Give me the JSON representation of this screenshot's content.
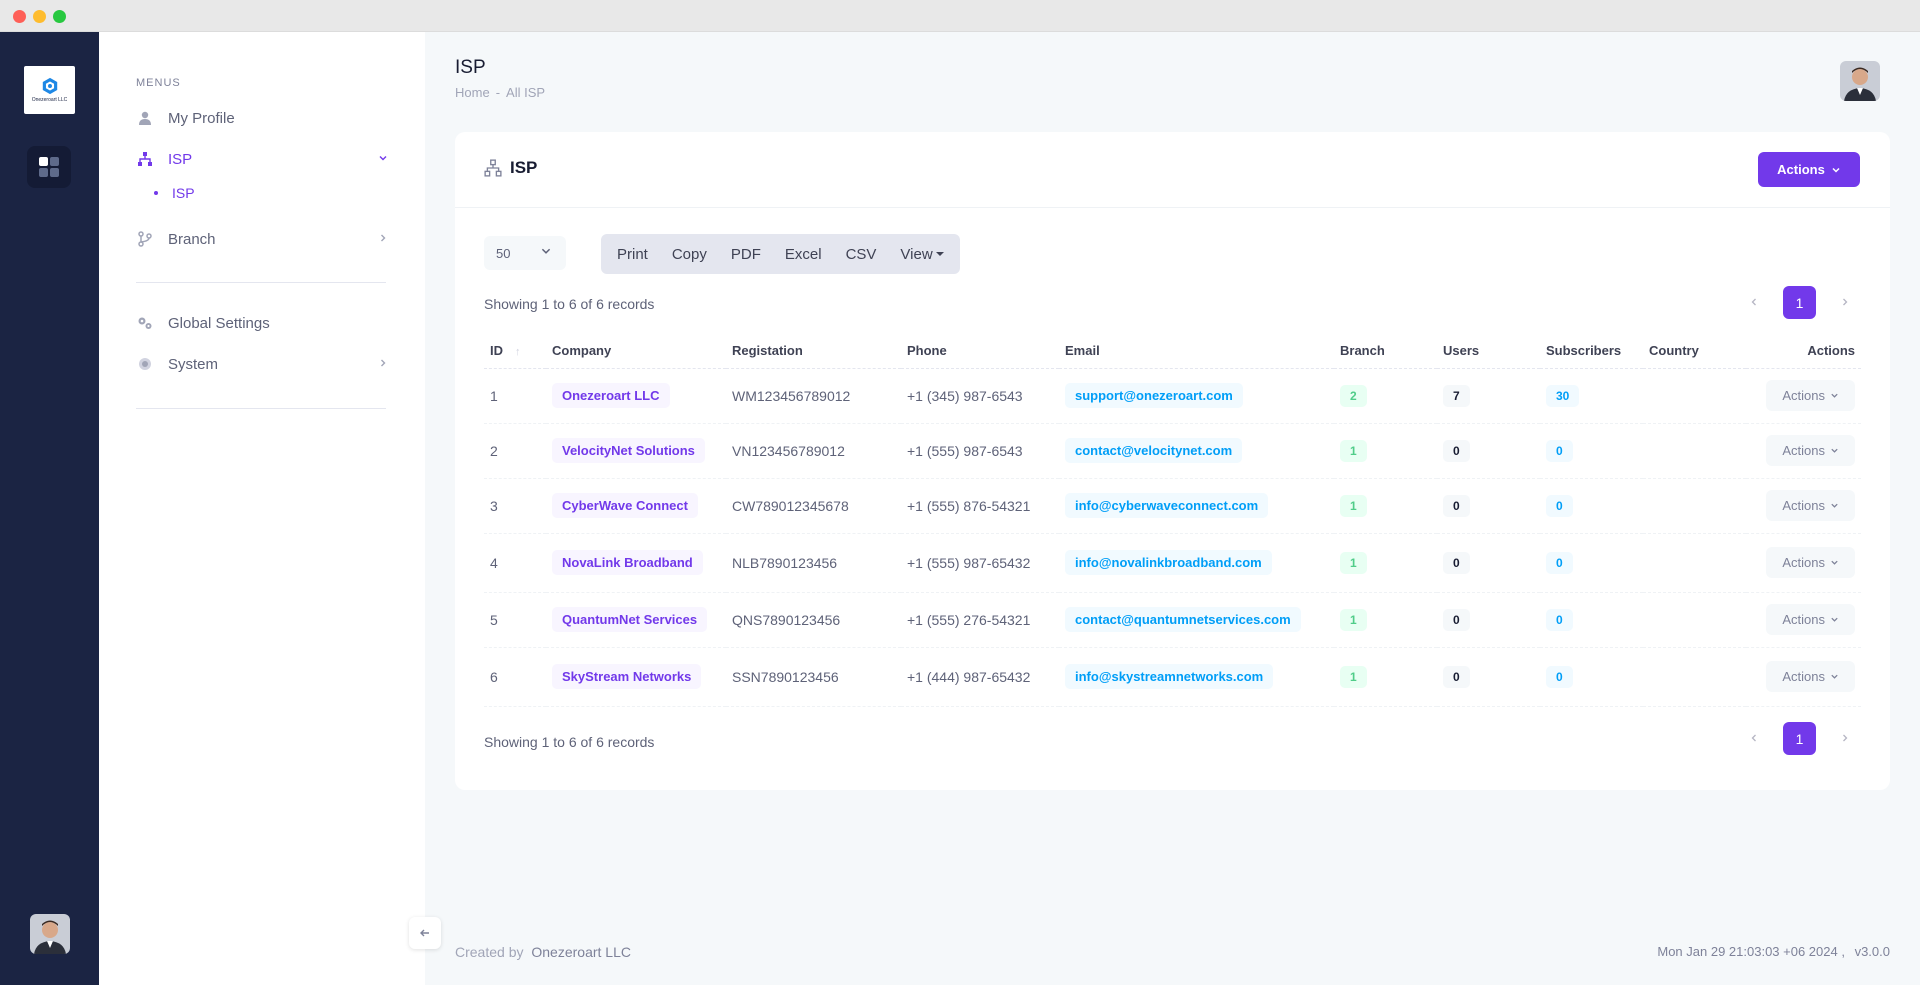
{
  "sidebar": {
    "logo_text": "Onezeroart LLC",
    "menus_label": "MENUS",
    "items": [
      {
        "label": "My Profile"
      },
      {
        "label": "ISP"
      },
      {
        "label": "ISP"
      },
      {
        "label": "Branch"
      },
      {
        "label": "Global Settings"
      },
      {
        "label": "System"
      }
    ]
  },
  "header": {
    "title": "ISP",
    "breadcrumb": {
      "home": "Home",
      "separator": "-",
      "current": "All ISP"
    }
  },
  "card": {
    "title": "ISP",
    "actions_label": "Actions",
    "length_value": "50",
    "export_buttons": [
      "Print",
      "Copy",
      "PDF",
      "Excel",
      "CSV",
      "View"
    ],
    "info_text": "Showing 1 to 6 of 6 records",
    "current_page": "1"
  },
  "table": {
    "columns": [
      "ID",
      "Company",
      "Registation",
      "Phone",
      "Email",
      "Branch",
      "Users",
      "Subscribers",
      "Country",
      "Actions"
    ],
    "rows": [
      {
        "id": "1",
        "company": "Onezeroart LLC",
        "registration": "WM123456789012",
        "phone": "+1 (345) 987-6543",
        "email": "support@onezeroart.com",
        "branch": "2",
        "users": "7",
        "subscribers": "30",
        "country": "",
        "action": "Actions"
      },
      {
        "id": "2",
        "company": "VelocityNet Solutions",
        "registration": "VN123456789012",
        "phone": "+1 (555) 987-6543",
        "email": "contact@velocitynet.com",
        "branch": "1",
        "users": "0",
        "subscribers": "0",
        "country": "",
        "action": "Actions"
      },
      {
        "id": "3",
        "company": "CyberWave Connect",
        "registration": "CW789012345678",
        "phone": "+1 (555) 876-54321",
        "email": "info@cyberwaveconnect.com",
        "branch": "1",
        "users": "0",
        "subscribers": "0",
        "country": "",
        "action": "Actions"
      },
      {
        "id": "4",
        "company": "NovaLink Broadband",
        "registration": "NLB7890123456",
        "phone": "+1 (555) 987-65432",
        "email": "info@novalinkbroadband.com",
        "branch": "1",
        "users": "0",
        "subscribers": "0",
        "country": "",
        "action": "Actions"
      },
      {
        "id": "5",
        "company": "QuantumNet Services",
        "registration": "QNS7890123456",
        "phone": "+1 (555) 276-54321",
        "email": "contact@quantumnetservices.com",
        "branch": "1",
        "users": "0",
        "subscribers": "0",
        "country": "",
        "action": "Actions"
      },
      {
        "id": "6",
        "company": "SkyStream Networks",
        "registration": "SSN7890123456",
        "phone": "+1 (444) 987-65432",
        "email": "info@skystreamnetworks.com",
        "branch": "1",
        "users": "0",
        "subscribers": "0",
        "country": "",
        "action": "Actions"
      }
    ]
  },
  "footer": {
    "created_by": "Created by",
    "brand": "Onezeroart LLC",
    "datetime": "Mon Jan 29 21:03:03 +06 2024 ,",
    "version": "v3.0.0"
  },
  "colors": {
    "accent": "#7239ea",
    "rail": "#1b2443",
    "info": "#009ef7",
    "success": "#50cd89"
  }
}
